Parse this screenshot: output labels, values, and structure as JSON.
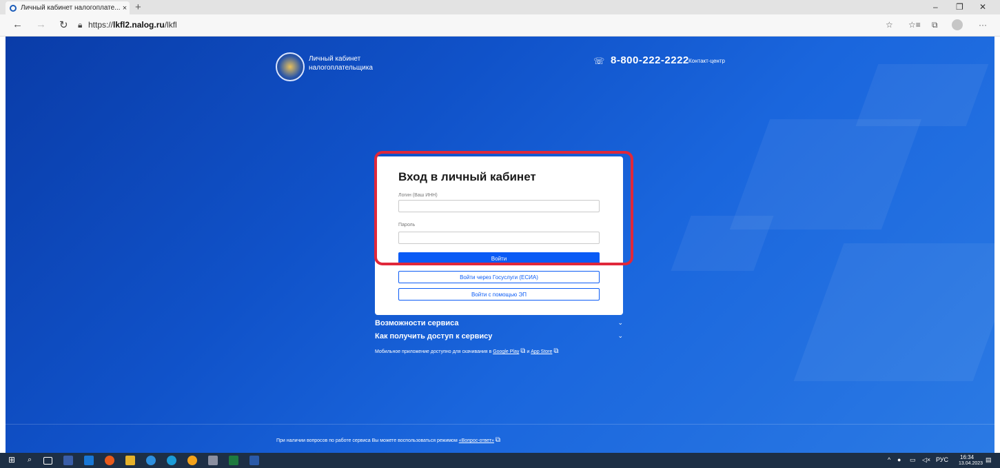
{
  "browser": {
    "tab_title": "Личный кабинет налогоплате...",
    "tab_close": "×",
    "new_tab": "+",
    "url_prefix": "https://",
    "url_host": "lkfl2.nalog.ru",
    "url_path": "/lkfl",
    "minimize": "–",
    "restore": "❐",
    "close": "✕",
    "more": "···"
  },
  "header": {
    "brand_line1": "Личный кабинет",
    "brand_line2": "налогоплательщика",
    "phone": "8-800-222-2222",
    "contact_label": "Контакт-центр"
  },
  "login": {
    "title": "Вход в личный кабинет",
    "login_label": "Логин (Ваш ИНН)",
    "login_value": "",
    "password_label": "Пароль",
    "password_value": "",
    "submit_label": "Войти",
    "gosuslugi_label": "Войти через Госуслуги (ЕСИА)",
    "ep_label": "Войти с помощью ЭП"
  },
  "accordion": [
    {
      "label": "Возможности сервиса"
    },
    {
      "label": "Как получить доступ к сервису"
    }
  ],
  "mobile": {
    "text": "Мобильное приложение доступно для скачивания в",
    "google_play": "Google Play",
    "and": "и",
    "app_store": "App Store"
  },
  "footer": {
    "text": "При наличии вопросов по работе сервиса Вы можете воспользоваться режимом",
    "link": "«Вопрос-ответ»"
  },
  "taskbar": {
    "lang": "РУС",
    "time": "16:34",
    "date": "13.04.2023"
  },
  "colors": {
    "primary": "#0a5bf5",
    "highlight": "#e0283a",
    "page_bg": "#1052c9"
  }
}
